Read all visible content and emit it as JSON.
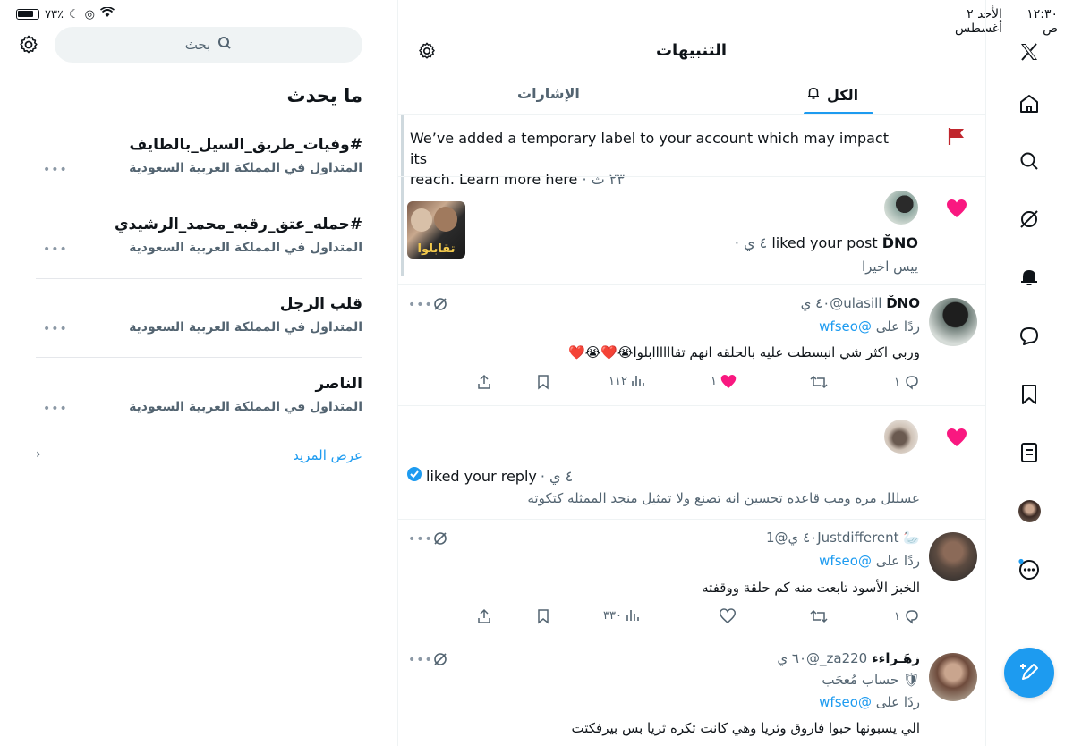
{
  "status": {
    "time": "١٢:٣٠ ص",
    "date": "الأحد ٢ أغسطس",
    "battery": "٧٣٪"
  },
  "sidebar": {
    "search_placeholder": "بحث",
    "trending_title": "ما يحدث",
    "trends": [
      {
        "title": "#وفيات_طريق_السيل_بالطايف",
        "meta": "المتداول في المملكة العربية السعودية"
      },
      {
        "title": "#حمله_عتق_رقبه_محمد_الرشيدي",
        "meta": "المتداول في المملكة العربية السعودية"
      },
      {
        "title": "قلب الرجل",
        "meta": "المتداول في المملكة العربية السعودية"
      },
      {
        "title": "الناصر",
        "meta": "المتداول في المملكة العربية السعودية"
      }
    ],
    "show_more": "عرض المزيد"
  },
  "main": {
    "title": "التنبيهات",
    "tabs": [
      {
        "label": "الكل",
        "active": true
      },
      {
        "label": "الإشارات",
        "active": false
      }
    ],
    "notice": {
      "line1": "We’ve added a temporary label to your account which may impact its",
      "line2": "reach. Learn more here",
      "time": "· ٢٣ ث"
    },
    "like1": {
      "username": "ĎNO",
      "action": "liked your post",
      "time": "· ٤ ي",
      "snippet": "ييس اخيرا",
      "thumb_text": "تقابلوا"
    },
    "reply1": {
      "name": "ĎNO",
      "handle": "@ulasill",
      "time": "٤٠ ي",
      "reply_to_prefix": "ردًا على",
      "reply_to": "@wfseo",
      "text": "وربي اكثر شي انبسطت عليه بالحلقه انهم تقاااااابلوا😭❤️😭❤️",
      "replies": "١",
      "likes": "١",
      "views": "١١٢"
    },
    "like2": {
      "action": "liked your reply",
      "time": "· ٤ ي",
      "snippet": "عسللل مره ومب قاعده تحسين انه تصنع ولا تمثيل منجد الممثله كتكوته"
    },
    "reply2": {
      "name": "1Justdifferent",
      "handle": "@",
      "time": "٤٠ ي",
      "reply_to_prefix": "ردًا على",
      "reply_to": "@wfseo",
      "text": "الخبز الأسود تابعت منه كم حلقة ووقفته",
      "replies": "١",
      "views": "٣٣٠"
    },
    "reply3": {
      "name": "زهَـراءء",
      "handle": "@_za220",
      "time": "٦٠ ي",
      "badge": "حساب مُعجَب",
      "reply_to_prefix": "ردًا على",
      "reply_to": "@wfseo",
      "text": "الي يسبونها حبوا فاروق وثريا وهي كانت تكره ثريا بس بيرفكتت"
    }
  },
  "colors": {
    "accent": "#1d9bf0",
    "like": "#f91880",
    "notice_flag": "#c0262d"
  }
}
